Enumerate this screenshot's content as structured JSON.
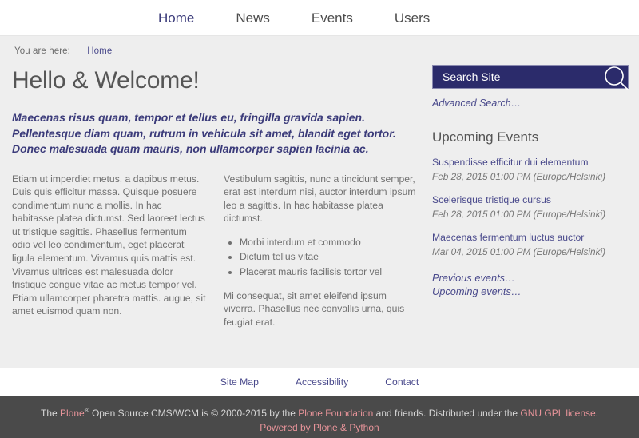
{
  "nav": {
    "items": [
      {
        "label": "Home",
        "current": true
      },
      {
        "label": "News",
        "current": false
      },
      {
        "label": "Events",
        "current": false
      },
      {
        "label": "Users",
        "current": false
      }
    ]
  },
  "breadcrumb": {
    "label": "You are here:",
    "home": "Home"
  },
  "main": {
    "title": "Hello & Welcome!",
    "description": "Maecenas risus quam, tempor et tellus eu, fringilla gravida sapien. Pellentesque diam quam, rutrum in vehicula sit amet, blandit eget tortor. Donec malesuada quam mauris, non ullamcorper sapien lacinia ac.",
    "left_column": {
      "paragraph_1": "Etiam ut imperdiet metus, a dapibus metus. Duis quis efficitur massa. Quisque posuere condimentum nunc a mollis. In hac habitasse platea dictumst. Sed laoreet lectus ut tristique sagittis. Phasellus fermentum odio vel leo condimentum, eget placerat ligula elementum. Vivamus quis mattis est. Vivamus ultrices est malesuada dolor tristique congue vitae ac metus tempor vel. Etiam ullamcorper pharetra mattis.  augue, sit amet euismod quam non."
    },
    "right_column": {
      "paragraph_1": "Vestibulum sagittis, nunc a tincidunt semper, erat est interdum nisi, auctor interdum ipsum leo a sagittis. In hac habitasse platea dictumst.",
      "list": [
        "Morbi interdum et commodo",
        "Dictum tellus vitae",
        "Placerat mauris facilisis tortor vel"
      ],
      "paragraph_2": "Mi consequat, sit amet eleifend ipsum viverra. Phasellus nec convallis urna, quis feugiat erat."
    }
  },
  "sidebar": {
    "search": {
      "placeholder": "Search Site",
      "value": "",
      "icon": "search-icon",
      "advanced_label": "Advanced Search…"
    },
    "events_portlet": {
      "title": "Upcoming Events",
      "items": [
        {
          "title": "Suspendisse efficitur dui elementum",
          "date": "Feb 28, 2015 01:00 PM (Europe/Helsinki)"
        },
        {
          "title": "Scelerisque tristique cursus",
          "date": "Feb 28, 2015 01:00 PM (Europe/Helsinki)"
        },
        {
          "title": "Maecenas fermentum luctus auctor",
          "date": "Mar 04, 2015 01:00 PM (Europe/Helsinki)"
        }
      ],
      "footer_links": [
        "Previous events…",
        "Upcoming events…"
      ]
    }
  },
  "site_actions": {
    "items": [
      "Site Map",
      "Accessibility",
      "Contact"
    ]
  },
  "footer": {
    "line1_part1": "The ",
    "line1_plone": "Plone",
    "line1_sup": "®",
    "line1_part2": " Open Source CMS/WCM is © 2000-2015 by the ",
    "line1_foundation": "Plone Foundation",
    "line1_part3": " and friends. Distributed under the ",
    "line1_license": "GNU GPL license.",
    "line2": "Powered by Plone & Python"
  },
  "colors": {
    "accent_navy": "#2b2b6b",
    "link_purple": "#4a4a8c",
    "footer_bg": "#4a4a4a",
    "footer_link": "#e8949a",
    "content_bg": "#eeeeee"
  }
}
